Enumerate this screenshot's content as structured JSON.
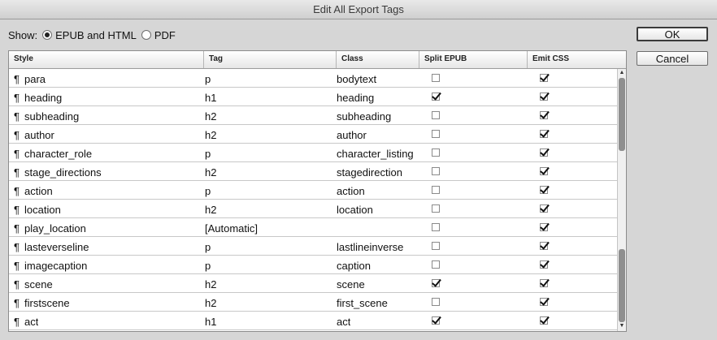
{
  "window": {
    "title": "Edit All Export Tags"
  },
  "show": {
    "label": "Show:",
    "options": [
      {
        "label": "EPUB and HTML",
        "selected": true
      },
      {
        "label": "PDF",
        "selected": false
      }
    ]
  },
  "buttons": {
    "ok": "OK",
    "cancel": "Cancel"
  },
  "table": {
    "columns": [
      "Style",
      "Tag",
      "Class",
      "Split EPUB",
      "Emit CSS"
    ],
    "paragraph_mark": "¶",
    "rows": [
      {
        "style": "para",
        "tag": "p",
        "class": "bodytext",
        "split_epub": false,
        "emit_css": true
      },
      {
        "style": "heading",
        "tag": "h1",
        "class": "heading",
        "split_epub": true,
        "emit_css": true
      },
      {
        "style": "subheading",
        "tag": "h2",
        "class": "subheading",
        "split_epub": false,
        "emit_css": true
      },
      {
        "style": "author",
        "tag": "h2",
        "class": "author",
        "split_epub": false,
        "emit_css": true
      },
      {
        "style": "character_role",
        "tag": "p",
        "class": "character_listing",
        "split_epub": false,
        "emit_css": true
      },
      {
        "style": "stage_directions",
        "tag": "h2",
        "class": "stagedirection",
        "split_epub": false,
        "emit_css": true
      },
      {
        "style": "action",
        "tag": "p",
        "class": "action",
        "split_epub": false,
        "emit_css": true
      },
      {
        "style": "location",
        "tag": "h2",
        "class": "location",
        "split_epub": false,
        "emit_css": true
      },
      {
        "style": "play_location",
        "tag": "[Automatic]",
        "class": "",
        "split_epub": false,
        "emit_css": true
      },
      {
        "style": "lasteverseline",
        "tag": "p",
        "class": "lastlineinverse",
        "split_epub": false,
        "emit_css": true
      },
      {
        "style": "imagecaption",
        "tag": "p",
        "class": "caption",
        "split_epub": false,
        "emit_css": true
      },
      {
        "style": "scene",
        "tag": "h2",
        "class": "scene",
        "split_epub": true,
        "emit_css": true
      },
      {
        "style": "firstscene",
        "tag": "h2",
        "class": "first_scene",
        "split_epub": false,
        "emit_css": true
      },
      {
        "style": "act",
        "tag": "h1",
        "class": "act",
        "split_epub": true,
        "emit_css": true
      }
    ]
  },
  "icons": {
    "scroll_up": "up-arrow-icon",
    "scroll_down": "down-arrow-icon",
    "radio_selected": "radio-selected-icon",
    "radio_unselected": "radio-unselected-icon"
  }
}
